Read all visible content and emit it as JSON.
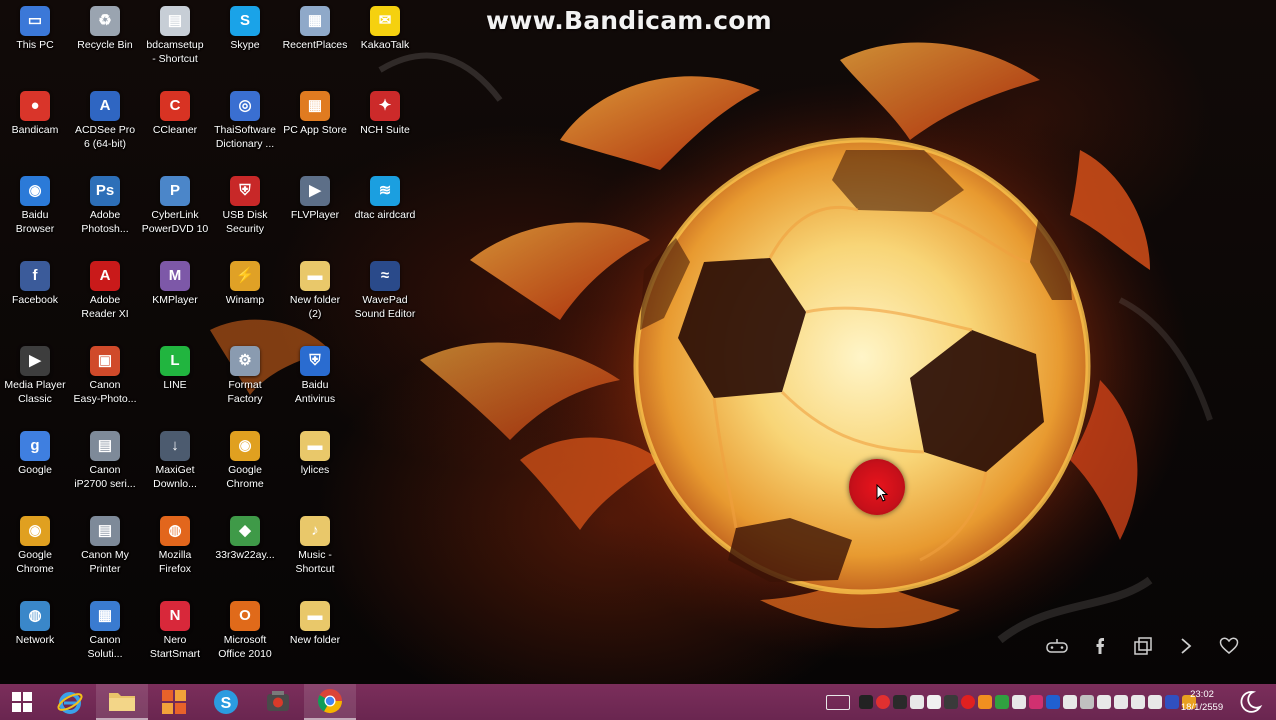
{
  "watermark": "www.Bandicam.com",
  "desktop_icons": [
    {
      "label": "This PC",
      "icon": "computer-icon",
      "color": "#3b78d8",
      "glyph": "▭"
    },
    {
      "label": "Recycle Bin",
      "icon": "recycle-bin-icon",
      "color": "#9aa4b0",
      "glyph": "♻"
    },
    {
      "label": "bdcamsetup\n- Shortcut",
      "icon": "installer-icon",
      "color": "#c7ced6",
      "glyph": "▤"
    },
    {
      "label": "Skype",
      "icon": "skype-icon",
      "color": "#1aa3e8",
      "glyph": "S"
    },
    {
      "label": "RecentPlaces",
      "icon": "recent-places-icon",
      "color": "#8fa9c9",
      "glyph": "▦"
    },
    {
      "label": "KakaoTalk",
      "icon": "kakaotalk-icon",
      "color": "#f5d10f",
      "glyph": "✉"
    },
    {
      "label": "Bandicam",
      "icon": "bandicam-icon",
      "color": "#d9352a",
      "glyph": "●"
    },
    {
      "label": "ACDSee Pro\n6 (64-bit)",
      "icon": "acdsee-icon",
      "color": "#2f66c2",
      "glyph": "A"
    },
    {
      "label": "CCleaner",
      "icon": "ccleaner-icon",
      "color": "#d83323",
      "glyph": "C"
    },
    {
      "label": "ThaiSoftware\nDictionary ...",
      "icon": "dictionary-icon",
      "color": "#3a6fd1",
      "glyph": "◎"
    },
    {
      "label": "PC App Store",
      "icon": "app-store-icon",
      "color": "#e07b20",
      "glyph": "▦"
    },
    {
      "label": "NCH Suite",
      "icon": "nch-suite-icon",
      "color": "#cc2a2a",
      "glyph": "✦"
    },
    {
      "label": "Baidu\nBrowser",
      "icon": "baidu-browser-icon",
      "color": "#2b7ad8",
      "glyph": "◉"
    },
    {
      "label": "Adobe\nPhotosh...",
      "icon": "photoshop-icon",
      "color": "#2d6fb8",
      "glyph": "Ps"
    },
    {
      "label": "CyberLink\nPowerDVD 10",
      "icon": "powerdvd-icon",
      "color": "#4b86c9",
      "glyph": "P"
    },
    {
      "label": "USB Disk\nSecurity",
      "icon": "usb-security-icon",
      "color": "#c82828",
      "glyph": "⛨"
    },
    {
      "label": "FLVPlayer",
      "icon": "flv-player-icon",
      "color": "#5d6f88",
      "glyph": "▶"
    },
    {
      "label": "dtac airdcard",
      "icon": "dtac-icon",
      "color": "#1b9fe0",
      "glyph": "≋"
    },
    {
      "label": "Facebook",
      "icon": "facebook-icon",
      "color": "#3b5b9a",
      "glyph": "f"
    },
    {
      "label": "Adobe\nReader XI",
      "icon": "adobe-reader-icon",
      "color": "#c91a1a",
      "glyph": "A"
    },
    {
      "label": "KMPlayer",
      "icon": "kmplayer-icon",
      "color": "#7d58a8",
      "glyph": "M"
    },
    {
      "label": "Winamp",
      "icon": "winamp-icon",
      "color": "#e0a126",
      "glyph": "⚡"
    },
    {
      "label": "New folder\n(2)",
      "icon": "folder-icon",
      "color": "#e9c86a",
      "glyph": "▬"
    },
    {
      "label": "WavePad\nSound Editor",
      "icon": "wavepad-icon",
      "color": "#2a4a8a",
      "glyph": "≈"
    },
    {
      "label": "Media Player\nClassic",
      "icon": "media-player-icon",
      "color": "#3d3d3d",
      "glyph": "▶"
    },
    {
      "label": "Canon\nEasy-Photo...",
      "icon": "canon-photo-icon",
      "color": "#d04a2a",
      "glyph": "▣"
    },
    {
      "label": "LINE",
      "icon": "line-icon",
      "color": "#21b53f",
      "glyph": "L"
    },
    {
      "label": "Format\nFactory",
      "icon": "format-factory-icon",
      "color": "#8a9bb0",
      "glyph": "⚙"
    },
    {
      "label": "Baidu\nAntivirus",
      "icon": "baidu-antivirus-icon",
      "color": "#2a6cd0",
      "glyph": "⛨"
    },
    {
      "label": "Google",
      "icon": "google-icon",
      "color": "#3f7fe0",
      "glyph": "g"
    },
    {
      "label": "Canon\niP2700 seri...",
      "icon": "printer-icon",
      "color": "#7e8a99",
      "glyph": "▤"
    },
    {
      "label": "MaxiGet\nDownlo...",
      "icon": "maxiget-icon",
      "color": "#4c5b6f",
      "glyph": "↓"
    },
    {
      "label": "Google\nChrome",
      "icon": "chrome-icon",
      "color": "#e0a020",
      "glyph": "◉"
    },
    {
      "label": "lylices",
      "icon": "folder-icon",
      "color": "#e9c86a",
      "glyph": "▬"
    },
    {
      "label": "Google\nChrome",
      "icon": "chrome-icon",
      "color": "#e0a020",
      "glyph": "◉"
    },
    {
      "label": "Canon My\nPrinter",
      "icon": "printer-icon",
      "color": "#7e8a99",
      "glyph": "▤"
    },
    {
      "label": "Mozilla\nFirefox",
      "icon": "firefox-icon",
      "color": "#e2661c",
      "glyph": "◍"
    },
    {
      "label": "33r3w22ay...",
      "icon": "file-icon",
      "color": "#3f9a48",
      "glyph": "◆"
    },
    {
      "label": "Music -\nShortcut",
      "icon": "music-folder-icon",
      "color": "#e9c86a",
      "glyph": "♪"
    },
    {
      "label": "Network",
      "icon": "network-icon",
      "color": "#3a87c9",
      "glyph": "◍"
    },
    {
      "label": "Canon\nSoluti...",
      "icon": "canon-solution-icon",
      "color": "#3a7bd0",
      "glyph": "▦"
    },
    {
      "label": "Nero\nStartSmart",
      "icon": "nero-icon",
      "color": "#d8283a",
      "glyph": "N"
    },
    {
      "label": "Microsoft\nOffice 2010",
      "icon": "office-icon",
      "color": "#e06a1a",
      "glyph": "O"
    },
    {
      "label": "New folder",
      "icon": "folder-icon",
      "color": "#e9c86a",
      "glyph": "▬"
    }
  ],
  "taskbar": {
    "buttons": [
      {
        "name": "start-button",
        "icon": "windows-logo-icon"
      },
      {
        "name": "internet-explorer-button",
        "icon": "internet-explorer-icon"
      },
      {
        "name": "file-explorer-button",
        "icon": "folder-icon"
      },
      {
        "name": "office-button",
        "icon": "office-icon"
      },
      {
        "name": "skype-button",
        "icon": "skype-icon"
      },
      {
        "name": "bandicam-button",
        "icon": "bandicam-icon"
      },
      {
        "name": "chrome-button",
        "icon": "chrome-icon"
      }
    ],
    "tray_colors": [
      "#222222",
      "#e03030",
      "#2a2a2a",
      "#e8e8e8",
      "#f0f0f0",
      "#3a3a3a",
      "#e02020",
      "#f09020",
      "#30a040",
      "#e8e8e8",
      "#d03070",
      "#2060d0",
      "#e8e8e8",
      "#c0c0c0",
      "#e8e8e8",
      "#e8e8e8",
      "#e8e8e8",
      "#e8e8e8",
      "#3050c0",
      "#e8a020"
    ],
    "clock_time": "23:02",
    "clock_date": "18/1/2559"
  }
}
